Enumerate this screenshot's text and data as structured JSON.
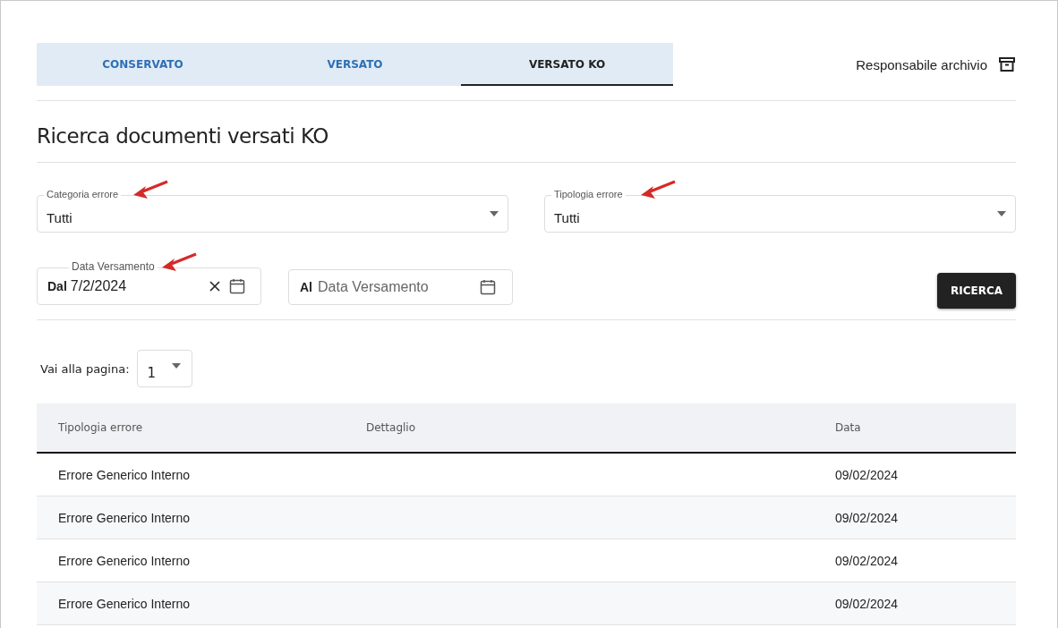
{
  "tabs": [
    {
      "label": "CONSERVATO",
      "selected": false
    },
    {
      "label": "VERSATO",
      "selected": false
    },
    {
      "label": "VERSATO KO",
      "selected": true
    }
  ],
  "user": {
    "role": "Responsabile archivio"
  },
  "title": "Ricerca documenti versati KO",
  "selects": [
    {
      "label": "Categoria errore",
      "value": "Tutti",
      "annotation_arrow": true
    },
    {
      "label": "Tipologia errore",
      "value": "Tutti",
      "annotation_arrow": true
    }
  ],
  "date_from": {
    "label": "Data Versamento",
    "prefix": "Dal",
    "value": "7/2/2024",
    "annotation_arrow": true
  },
  "date_to": {
    "prefix": "Al",
    "placeholder": "Data Versamento"
  },
  "search_button": "RICERCA",
  "pager": {
    "label": "Vai alla pagina:",
    "value": "1"
  },
  "table": {
    "columns": [
      "Tipologia errore",
      "Dettaglio",
      "Data"
    ],
    "rows": [
      [
        "Errore Generico Interno",
        "",
        "09/02/2024"
      ],
      [
        "Errore Generico Interno",
        "",
        "09/02/2024"
      ],
      [
        "Errore Generico Interno",
        "",
        "09/02/2024"
      ],
      [
        "Errore Generico Interno",
        "",
        "09/02/2024"
      ]
    ]
  }
}
